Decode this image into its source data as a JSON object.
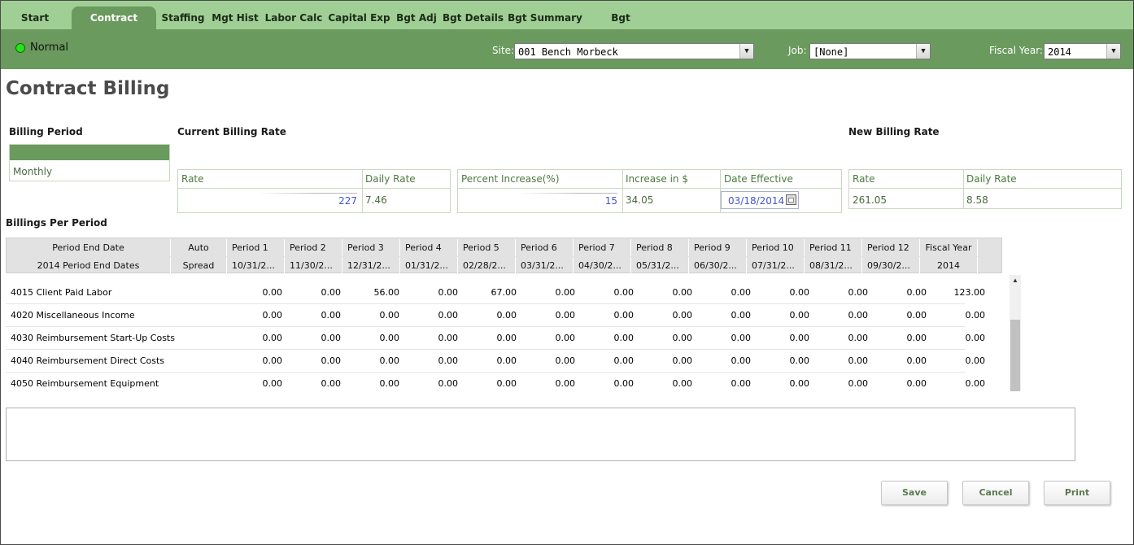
{
  "tabs": [
    "Start Budget",
    "Contract Billing",
    "Staffing",
    "Mgt Hist",
    "Labor Calc",
    "Capital Exp",
    "Bgt Adj",
    "Bgt Details",
    "Bgt Summary",
    "Bgt Approval"
  ],
  "active_tab": "Contract Billing",
  "header": {
    "status": "Normal",
    "site_label": "Site:",
    "site_value": "001 Bench Morbeck",
    "job_label": "Job:",
    "job_value": "[None]",
    "fy_label": "Fiscal Year:",
    "fy_value": "2014"
  },
  "page_title": "Contract Billing",
  "billing_period": {
    "label": "Billing Period",
    "option": "Monthly"
  },
  "current_rate": {
    "label": "Current Billing Rate",
    "rate_header": "Rate",
    "rate_value": "227",
    "daily_header": "Daily Rate",
    "daily_value": "7.46",
    "pct_header": "Percent Increase(%)",
    "pct_value": "15",
    "inc_header": "Increase in $",
    "inc_value": "34.05",
    "date_header": "Date Effective",
    "date_value": "03/18/2014"
  },
  "new_rate": {
    "label": "New Billing Rate",
    "rate_header": "Rate",
    "rate_value": "261.05",
    "daily_header": "Daily Rate",
    "daily_value": "8.58"
  },
  "billings": {
    "label": "Billings Per Period",
    "header_row1": [
      "Period End Date",
      "Auto",
      "Period 1",
      "Period 2",
      "Period 3",
      "Period 4",
      "Period 5",
      "Period 6",
      "Period 7",
      "Period 8",
      "Period 9",
      "Period 10",
      "Period 11",
      "Period 12",
      "Fiscal Year"
    ],
    "header_row2": [
      "2014 Period End Dates",
      "Spread",
      "10/31/2...",
      "11/30/2...",
      "12/31/2...",
      "01/31/2...",
      "02/28/2...",
      "03/31/2...",
      "04/30/2...",
      "05/31/2...",
      "06/30/2...",
      "07/31/2...",
      "08/31/2...",
      "09/30/2...",
      "2014"
    ],
    "rows": [
      {
        "name": "4015 Client Paid Labor",
        "values": [
          "0.00",
          "0.00",
          "56.00",
          "0.00",
          "67.00",
          "0.00",
          "0.00",
          "0.00",
          "0.00",
          "0.00",
          "0.00",
          "0.00",
          "123.00"
        ]
      },
      {
        "name": "4020 Miscellaneous Income",
        "values": [
          "0.00",
          "0.00",
          "0.00",
          "0.00",
          "0.00",
          "0.00",
          "0.00",
          "0.00",
          "0.00",
          "0.00",
          "0.00",
          "0.00",
          "0.00"
        ]
      },
      {
        "name": "4030 Reimbursement Start-Up Costs",
        "values": [
          "0.00",
          "0.00",
          "0.00",
          "0.00",
          "0.00",
          "0.00",
          "0.00",
          "0.00",
          "0.00",
          "0.00",
          "0.00",
          "0.00",
          "0.00"
        ]
      },
      {
        "name": "4040 Reimbursement Direct Costs",
        "values": [
          "0.00",
          "0.00",
          "0.00",
          "0.00",
          "0.00",
          "0.00",
          "0.00",
          "0.00",
          "0.00",
          "0.00",
          "0.00",
          "0.00",
          "0.00"
        ]
      },
      {
        "name": "4050 Reimbursement Equipment",
        "values": [
          "0.00",
          "0.00",
          "0.00",
          "0.00",
          "0.00",
          "0.00",
          "0.00",
          "0.00",
          "0.00",
          "0.00",
          "0.00",
          "0.00",
          "0.00"
        ]
      }
    ]
  },
  "buttons": {
    "save": "Save",
    "cancel": "Cancel",
    "print": "Print"
  }
}
